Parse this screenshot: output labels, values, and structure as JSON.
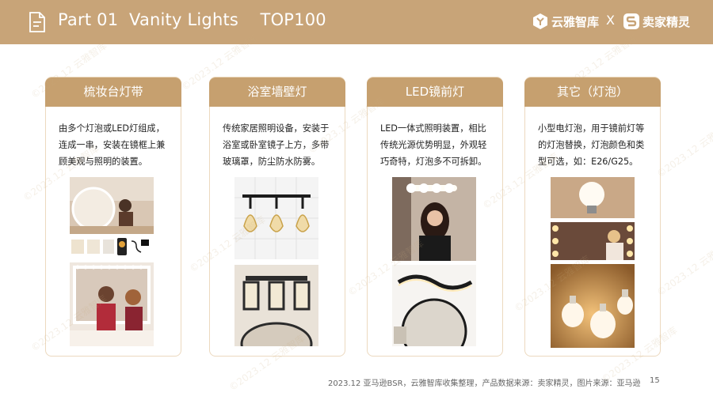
{
  "header": {
    "title": "Part 01  Vanity Lights    TOP100",
    "brand1": "云雅智库",
    "separator": "X",
    "brand2": "卖家精灵"
  },
  "cards": [
    {
      "title": "梳妆台灯带",
      "desc": "由多个灯泡或LED灯组成，连成一串，安装在镜框上兼顾美观与照明的装置。"
    },
    {
      "title": "浴室墙壁灯",
      "desc": "传统家居照明设备，安装于浴室或卧室镜子上方，多带玻璃罩，防尘防水防雾。"
    },
    {
      "title": "LED镜前灯",
      "desc": "LED一体式照明装置，相比传统光源优势明显，外观轻巧奇特，灯泡多不可拆卸。"
    },
    {
      "title": "其它（灯泡）",
      "desc": "小型电灯泡，用于镜前灯等的灯泡替换，灯泡颜色和类型可选，如：E26/G25。"
    }
  ],
  "footer": {
    "source": "2023.12 亚马逊BSR，云雅智库收集整理，产品数据来源：卖家精灵，图片来源：亚马逊",
    "page": "15"
  },
  "watermark": "©2023.12 云雅智库"
}
